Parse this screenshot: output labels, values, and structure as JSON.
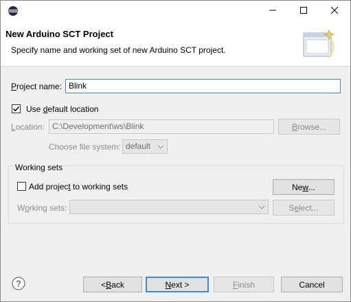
{
  "window": {
    "title_icon": "eclipse-icon",
    "minimize_icon": "minimize-icon",
    "maximize_icon": "maximize-icon",
    "close_icon": "close-icon"
  },
  "banner": {
    "title": "New Arduino SCT Project",
    "description": "Specify name and working set of new Arduino SCT project.",
    "image_icon": "new-project-wizard-icon"
  },
  "project": {
    "name_label_prefix": "P",
    "name_label_rest": "roject name:",
    "name_value": "Blink"
  },
  "location": {
    "use_default_prefix": "Use ",
    "use_default_accel": "d",
    "use_default_rest": "efault location",
    "use_default_checked": true,
    "label_accel": "L",
    "label_rest": "ocation:",
    "value": "C:\\Development\\ws\\Blink",
    "browse_prefix": "B",
    "browse_rest": "rowse...",
    "filesystem_label": "Choose file system:",
    "filesystem_value": "default"
  },
  "working_sets": {
    "group_title": "Working sets",
    "add_prefix": "Add projec",
    "add_accel": "t",
    "add_rest": " to working sets",
    "add_checked": false,
    "new_prefix": "Ne",
    "new_accel": "w",
    "new_rest": "...",
    "label_prefix": "W",
    "label_accel": "o",
    "label_rest": "rking sets:",
    "value": "",
    "select_prefix": "S",
    "select_accel": "e",
    "select_rest": "lect..."
  },
  "footer": {
    "help_icon": "help-icon",
    "back_prefix": "< ",
    "back_accel": "B",
    "back_rest": "ack",
    "next_accel": "N",
    "next_rest": "ext >",
    "finish_accel": "F",
    "finish_rest": "inish",
    "cancel_label": "Cancel"
  }
}
